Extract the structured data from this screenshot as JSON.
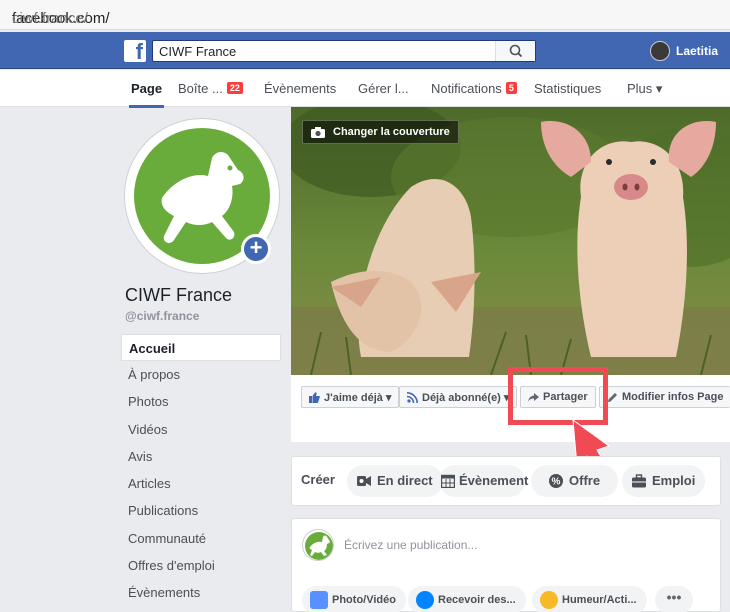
{
  "browser": {
    "url_domain": "facebook.com/",
    "url_path": "ciwf.france/"
  },
  "topbar": {
    "search_value": "CIWF France",
    "user_name": "Laetitia"
  },
  "tabs": [
    {
      "label": "Page",
      "active": true
    },
    {
      "label": "Boîte ...",
      "badge": "22"
    },
    {
      "label": "Évènements"
    },
    {
      "label": "Gérer l..."
    },
    {
      "label": "Notifications",
      "badge": "5"
    },
    {
      "label": "Statistiques"
    },
    {
      "label": "Plus ▾"
    }
  ],
  "page": {
    "name": "CIWF France",
    "handle": "@ciwf.france"
  },
  "nav": [
    "Accueil",
    "À propos",
    "Photos",
    "Vidéos",
    "Avis",
    "Articles",
    "Publications",
    "Communauté",
    "Offres d'emploi",
    "Évènements"
  ],
  "cover": {
    "change_label": "Changer la couverture"
  },
  "actions": {
    "like": "J'aime déjà ▾",
    "follow": "Déjà abonné(e) ▾",
    "share": "Partager",
    "edit": "Modifier infos Page"
  },
  "create": {
    "label": "Créer",
    "live": "En direct",
    "event": "Évènement",
    "offer": "Offre",
    "job": "Emploi"
  },
  "composer": {
    "placeholder": "Écrivez une publication...",
    "photo": "Photo/Vidéo",
    "receive": "Recevoir des...",
    "mood": "Humeur/Acti...",
    "more": "•••"
  },
  "colors": {
    "fb_blue": "#4267b2",
    "highlight": "#f04a55",
    "brand_green": "#6aac3b"
  }
}
